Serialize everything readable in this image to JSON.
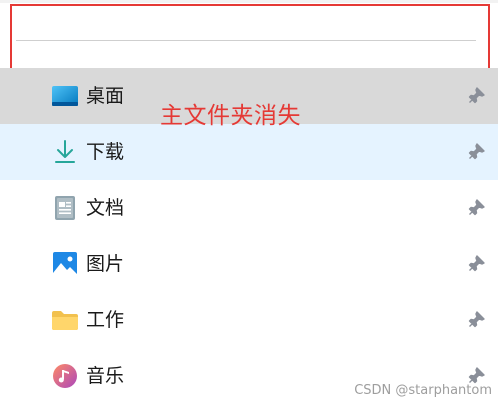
{
  "annotation": {
    "text": "主文件夹消失",
    "color": "#e53935"
  },
  "quick_access": {
    "items": [
      {
        "label": "桌面",
        "icon": "desktop-icon",
        "pinned": true,
        "state": "hover"
      },
      {
        "label": "下载",
        "icon": "download-icon",
        "pinned": true,
        "state": "selected"
      },
      {
        "label": "文档",
        "icon": "documents-icon",
        "pinned": true,
        "state": "normal"
      },
      {
        "label": "图片",
        "icon": "pictures-icon",
        "pinned": true,
        "state": "normal"
      },
      {
        "label": "工作",
        "icon": "folder-icon",
        "pinned": true,
        "state": "normal"
      },
      {
        "label": "音乐",
        "icon": "music-icon",
        "pinned": true,
        "state": "normal"
      }
    ]
  },
  "watermark": "CSDN @starphantom",
  "colors": {
    "hover_bg": "#d9d9d9",
    "selected_bg": "#e5f3ff",
    "pin": "#8a8f99"
  }
}
